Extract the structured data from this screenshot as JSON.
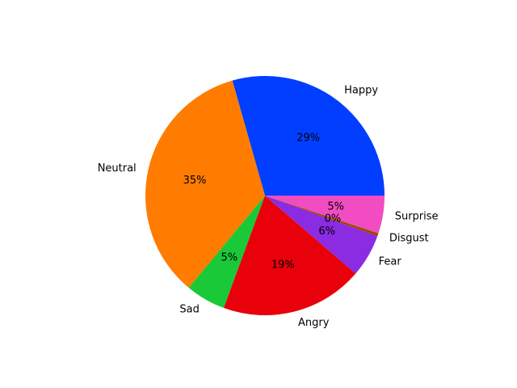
{
  "chart_data": {
    "type": "pie",
    "title": "",
    "start_angle_deg": 0,
    "direction": "counterclockwise",
    "slices": [
      {
        "label": "Happy",
        "value": 29.4,
        "pct_label": "29%",
        "color": "#023eff"
      },
      {
        "label": "Neutral",
        "value": 34.6,
        "pct_label": "35%",
        "color": "#ff7c00"
      },
      {
        "label": "Sad",
        "value": 5.4,
        "pct_label": "5%",
        "color": "#1ac938"
      },
      {
        "label": "Angry",
        "value": 19.3,
        "pct_label": "19%",
        "color": "#e8000b"
      },
      {
        "label": "Fear",
        "value": 5.8,
        "pct_label": "6%",
        "color": "#8b2be2"
      },
      {
        "label": "Disgust",
        "value": 0.4,
        "pct_label": "0%",
        "color": "#9f4800"
      },
      {
        "label": "Surprise",
        "value": 5.1,
        "pct_label": "5%",
        "color": "#f14cc1"
      }
    ]
  }
}
